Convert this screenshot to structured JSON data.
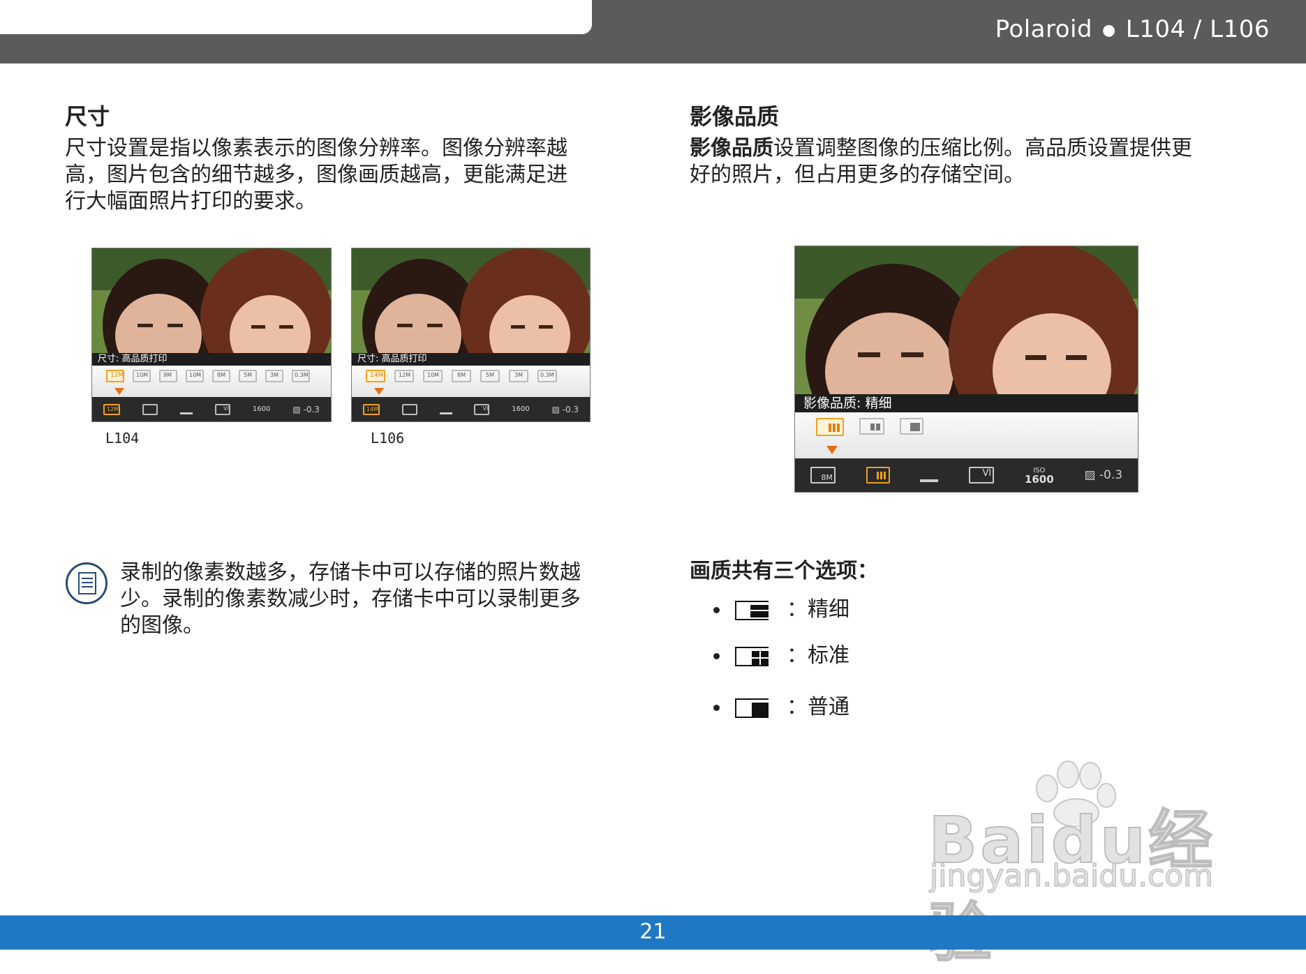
{
  "header": {
    "brand": "Polaroid",
    "model": "L104 / L106"
  },
  "left": {
    "heading": "尺寸",
    "lines": [
      "尺寸设置是指以像素表示的图像分辨率。图像分辨率越",
      "高，图片包含的细节越多，图像画质越高，更能满足进",
      "行大幅面照片打印的要求。"
    ],
    "screens": [
      {
        "caption": "L104",
        "strip": "尺寸: 高品质打印",
        "menu": [
          "12M",
          "10M",
          "9M",
          "10M",
          "8M",
          "5M",
          "3M",
          "0.3M"
        ],
        "menu_prefix": [
          "",
          "3:2",
          "16:9",
          "",
          "",
          "",
          "",
          ""
        ],
        "bottom": [
          "12M",
          "",
          "",
          "VI",
          "1600",
          "-0.3"
        ]
      },
      {
        "caption": "L106",
        "strip": "尺寸: 高品质打印",
        "menu": [
          "14M",
          "12M",
          "10M",
          "8M",
          "5M",
          "3M",
          "0.3M"
        ],
        "menu_prefix": [
          "",
          "3:2",
          "16:9",
          "",
          "",
          "",
          ""
        ],
        "bottom": [
          "14M",
          "",
          "",
          "VI",
          "1600",
          "-0.3"
        ]
      }
    ],
    "note_lines": [
      "录制的像素数越多，存储卡中可以存储的照片数越",
      "少。录制的像素数减少时，存储卡中可以录制更多",
      "的图像。"
    ]
  },
  "right": {
    "heading": "影像品质",
    "lead_bold": "影像品质",
    "lead_rest": "设置调整图像的压缩比例。高品质设置提供更",
    "line2": "好的照片，但占用更多的存储空间。",
    "screen": {
      "strip": "影像品质: 精细",
      "bottom": [
        "8M",
        "",
        "",
        "VI",
        "ISO",
        "1600",
        "-0.3"
      ]
    },
    "options_title": "画质共有三个选项：",
    "options": [
      {
        "label": "：精细",
        "icon": "quality-fine-icon"
      },
      {
        "label": "：标准",
        "icon": "quality-normal-icon"
      },
      {
        "label": "：普通",
        "icon": "quality-economy-icon"
      }
    ]
  },
  "watermark": {
    "brand": "Baidu经验",
    "url": "jingyan.baidu.com"
  },
  "footer": {
    "page": "21"
  }
}
